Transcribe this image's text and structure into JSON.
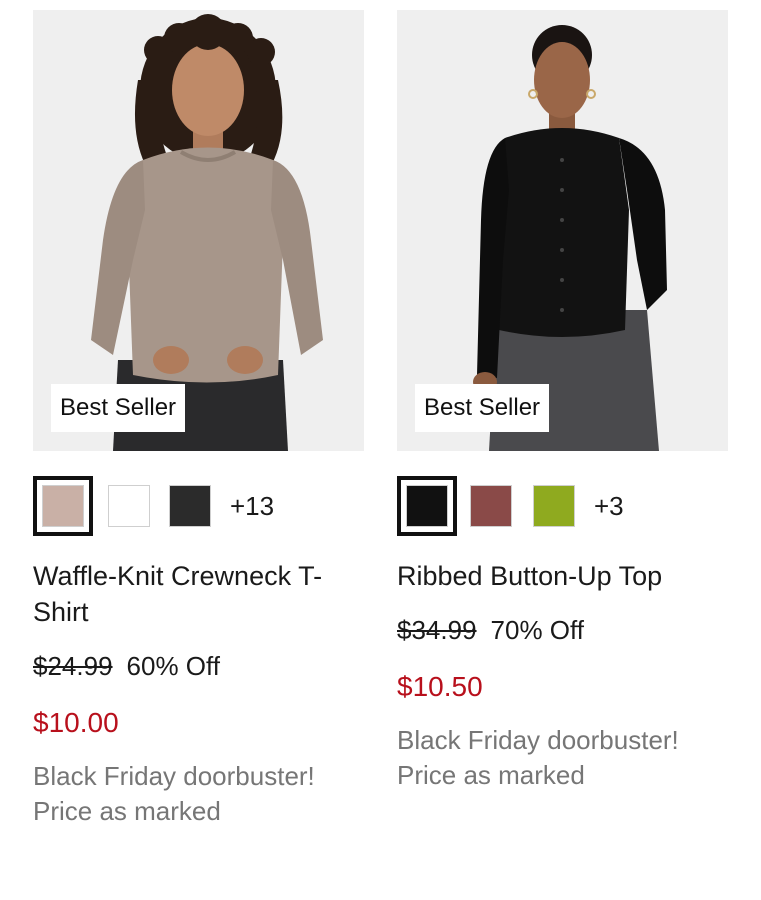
{
  "products": [
    {
      "name": "Waffle-Knit Crewneck T-Shirt",
      "badge": "Best Seller",
      "image_description": "Woman with curly hair wearing a taupe waffle-knit long-sleeve crewneck tee and black jeans",
      "swatches": [
        {
          "color": "#c9b0a6",
          "label": "taupe",
          "selected": true
        },
        {
          "color": "#ffffff",
          "label": "white",
          "selected": false
        },
        {
          "color": "#2b2b2b",
          "label": "black",
          "selected": false
        }
      ],
      "more_colors": "+13",
      "original_price": "$24.99",
      "discount": "60% Off",
      "sale_price": "$10.00",
      "promo": "Black Friday doorbuster! Price as marked"
    },
    {
      "name": "Ribbed Button-Up Top",
      "badge": "Best Seller",
      "image_description": "Woman wearing a black ribbed long-sleeve button-up top and grey jeans",
      "swatches": [
        {
          "color": "#111111",
          "label": "black",
          "selected": true
        },
        {
          "color": "#8a4a48",
          "label": "burgundy",
          "selected": false
        },
        {
          "color": "#8faa1f",
          "label": "green",
          "selected": false
        }
      ],
      "more_colors": "+3",
      "original_price": "$34.99",
      "discount": "70% Off",
      "sale_price": "$10.50",
      "promo": "Black Friday doorbuster! Price as marked"
    }
  ],
  "colors": {
    "sale_price": "#b8101c",
    "promo_text": "#767676",
    "image_background": "#efefef"
  }
}
